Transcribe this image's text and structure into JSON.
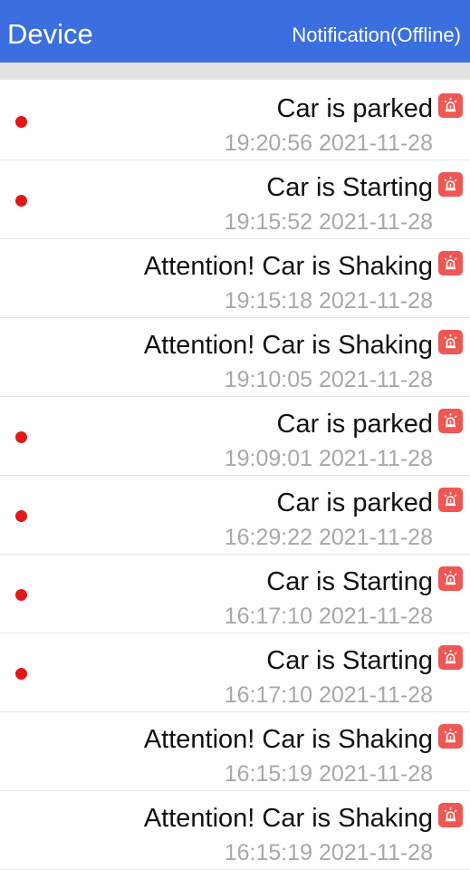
{
  "header": {
    "title": "Device",
    "action": "Notification(Offline)"
  },
  "colors": {
    "header_bg": "#3b6fe0",
    "unread_dot": "#e01818",
    "alarm_icon": "#ee5753",
    "timestamp": "#a8a8a8"
  },
  "notifications": [
    {
      "message": "Car is parked",
      "time": "19:20:56 2021-11-28",
      "unread": true,
      "icon": "alarm-icon"
    },
    {
      "message": "Car is Starting",
      "time": "19:15:52 2021-11-28",
      "unread": true,
      "icon": "alarm-icon"
    },
    {
      "message": "Attention! Car is Shaking",
      "time": "19:15:18 2021-11-28",
      "unread": false,
      "icon": "alarm-icon"
    },
    {
      "message": "Attention! Car is Shaking",
      "time": "19:10:05 2021-11-28",
      "unread": false,
      "icon": "alarm-icon"
    },
    {
      "message": "Car is parked",
      "time": "19:09:01 2021-11-28",
      "unread": true,
      "icon": "alarm-icon"
    },
    {
      "message": "Car is parked",
      "time": "16:29:22 2021-11-28",
      "unread": true,
      "icon": "alarm-icon"
    },
    {
      "message": "Car is Starting",
      "time": "16:17:10 2021-11-28",
      "unread": true,
      "icon": "alarm-icon"
    },
    {
      "message": "Car is Starting",
      "time": "16:17:10 2021-11-28",
      "unread": true,
      "icon": "alarm-icon"
    },
    {
      "message": "Attention! Car is Shaking",
      "time": "16:15:19 2021-11-28",
      "unread": false,
      "icon": "alarm-icon"
    },
    {
      "message": "Attention! Car is Shaking",
      "time": "16:15:19 2021-11-28",
      "unread": false,
      "icon": "alarm-icon"
    }
  ]
}
